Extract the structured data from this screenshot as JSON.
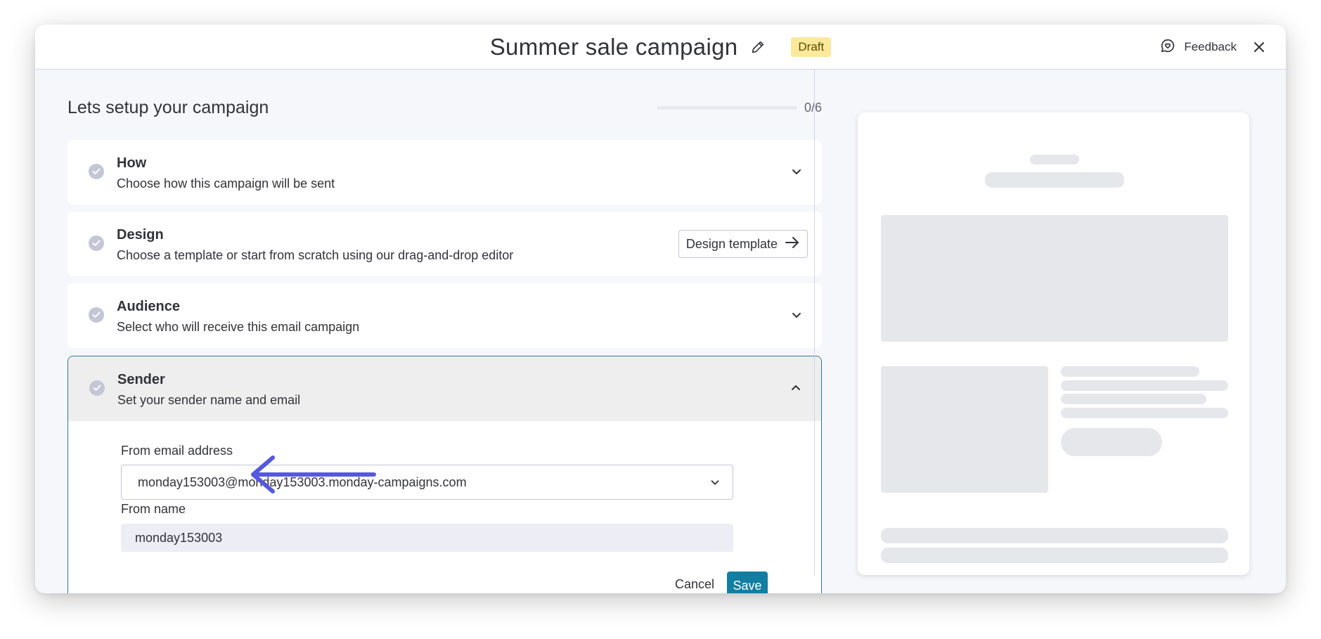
{
  "header": {
    "title": "Summer sale campaign",
    "edit_icon": "pencil-icon",
    "status_badge": "Draft",
    "feedback_label": "Feedback",
    "feedback_icon": "chat-heart-icon",
    "close_icon": "close-icon"
  },
  "setup": {
    "title": "Lets setup your campaign",
    "progress_text": "0/6",
    "progress_fraction": 0
  },
  "steps": [
    {
      "name": "How",
      "description": "Choose how this campaign will be sent",
      "icon": "chevron-down-icon"
    },
    {
      "name": "Design",
      "description": "Choose a template or start from scratch using our drag-and-drop editor",
      "button_label": "Design template",
      "button_icon": "arrow-right-icon"
    },
    {
      "name": "Audience",
      "description": "Select who will receive this email campaign",
      "icon": "chevron-down-icon"
    },
    {
      "name": "Sender",
      "description": "Set your sender name and email",
      "icon": "chevron-up-icon"
    }
  ],
  "sender_form": {
    "from_email_label": "From email address",
    "from_email_value": "monday153003@monday153003.monday-campaigns.com",
    "from_name_label": "From name",
    "from_name_value": "monday153003",
    "cancel_label": "Cancel",
    "save_label": "Save"
  },
  "colors": {
    "accent": "#127ea1",
    "draft_badge": "#fce99b",
    "annotation_arrow": "#5559df"
  }
}
